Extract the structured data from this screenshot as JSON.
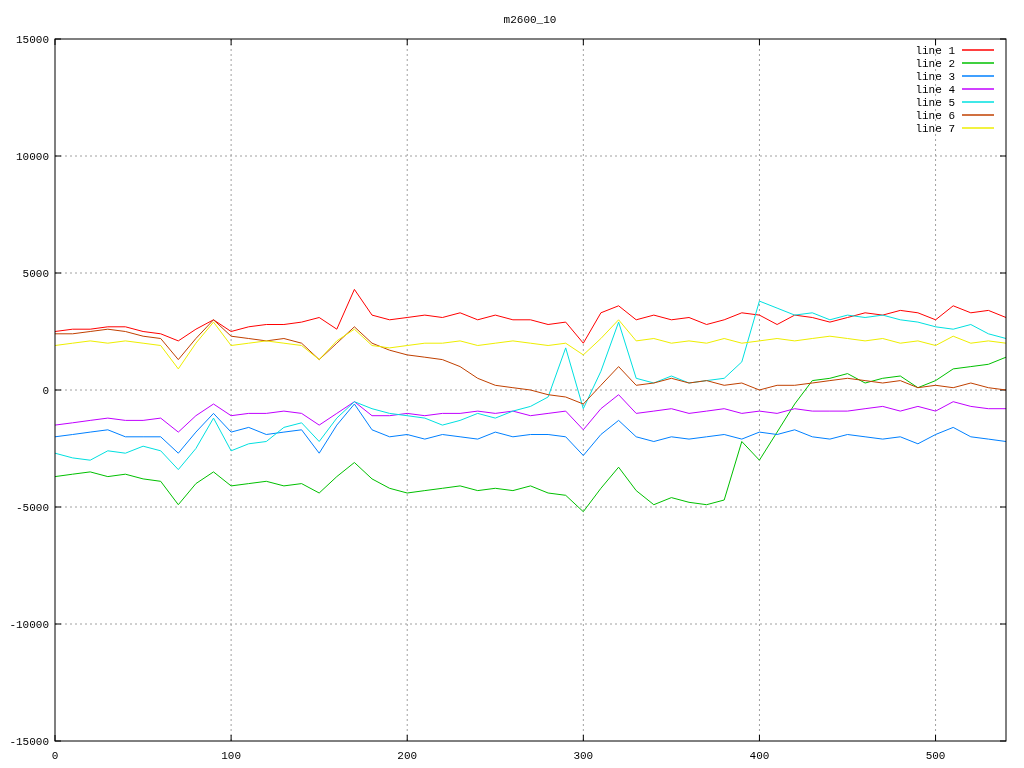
{
  "chart_data": {
    "type": "line",
    "title": "m2600_10",
    "x": [
      0,
      10,
      20,
      30,
      40,
      50,
      60,
      70,
      80,
      90,
      100,
      110,
      120,
      130,
      140,
      150,
      160,
      170,
      180,
      190,
      200,
      210,
      220,
      230,
      240,
      250,
      260,
      270,
      280,
      290,
      300,
      310,
      320,
      330,
      340,
      350,
      360,
      370,
      380,
      390,
      400,
      410,
      420,
      430,
      440,
      450,
      460,
      470,
      480,
      490,
      500,
      510,
      520,
      530,
      540
    ],
    "series": [
      {
        "name": "line 1",
        "color": "#ff0000",
        "values": [
          2500,
          2600,
          2600,
          2700,
          2700,
          2500,
          2400,
          2100,
          2600,
          3000,
          2500,
          2700,
          2800,
          2800,
          2900,
          3100,
          2600,
          4300,
          3200,
          3000,
          3100,
          3200,
          3100,
          3300,
          3000,
          3200,
          3000,
          3000,
          2800,
          2900,
          2000,
          3300,
          3600,
          3000,
          3200,
          3000,
          3100,
          2800,
          3000,
          3300,
          3200,
          2800,
          3200,
          3100,
          2900,
          3100,
          3300,
          3200,
          3400,
          3300,
          3000,
          3600,
          3300,
          3400,
          3100
        ]
      },
      {
        "name": "line 2",
        "color": "#00c000",
        "values": [
          -3700,
          -3600,
          -3500,
          -3700,
          -3600,
          -3800,
          -3900,
          -4900,
          -4000,
          -3500,
          -4100,
          -4000,
          -3900,
          -4100,
          -4000,
          -4400,
          -3700,
          -3100,
          -3800,
          -4200,
          -4400,
          -4300,
          -4200,
          -4100,
          -4300,
          -4200,
          -4300,
          -4100,
          -4400,
          -4500,
          -5200,
          -4200,
          -3300,
          -4300,
          -4900,
          -4600,
          -4800,
          -4900,
          -4700,
          -2200,
          -3000,
          -1800,
          -600,
          400,
          500,
          700,
          300,
          500,
          600,
          100,
          400,
          900,
          1000,
          1100,
          1400
        ]
      },
      {
        "name": "line 3",
        "color": "#0080ff",
        "values": [
          -2000,
          -1900,
          -1800,
          -1700,
          -2000,
          -2000,
          -2000,
          -2700,
          -1800,
          -1000,
          -1800,
          -1600,
          -1900,
          -1800,
          -1700,
          -2700,
          -1500,
          -600,
          -1700,
          -2000,
          -1900,
          -2100,
          -1900,
          -2000,
          -2100,
          -1800,
          -2000,
          -1900,
          -1900,
          -2000,
          -2800,
          -1900,
          -1300,
          -2000,
          -2200,
          -2000,
          -2100,
          -2000,
          -1900,
          -2100,
          -1800,
          -1900,
          -1700,
          -2000,
          -2100,
          -1900,
          -2000,
          -2100,
          -2000,
          -2300,
          -1900,
          -1600,
          -2000,
          -2100,
          -2200
        ]
      },
      {
        "name": "line 4",
        "color": "#c000ff",
        "values": [
          -1500,
          -1400,
          -1300,
          -1200,
          -1300,
          -1300,
          -1200,
          -1800,
          -1100,
          -600,
          -1100,
          -1000,
          -1000,
          -900,
          -1000,
          -1500,
          -1000,
          -500,
          -1100,
          -1100,
          -1000,
          -1100,
          -1000,
          -1000,
          -900,
          -1000,
          -900,
          -1100,
          -1000,
          -900,
          -1700,
          -800,
          -200,
          -1000,
          -900,
          -800,
          -1000,
          -900,
          -800,
          -1000,
          -900,
          -1000,
          -800,
          -900,
          -900,
          -900,
          -800,
          -700,
          -900,
          -700,
          -900,
          -500,
          -700,
          -800,
          -800
        ]
      },
      {
        "name": "line 5",
        "color": "#00e0e0",
        "values": [
          -2700,
          -2900,
          -3000,
          -2600,
          -2700,
          -2400,
          -2600,
          -3400,
          -2500,
          -1200,
          -2600,
          -2300,
          -2200,
          -1600,
          -1400,
          -2200,
          -1200,
          -500,
          -800,
          -1000,
          -1100,
          -1200,
          -1500,
          -1300,
          -1000,
          -1200,
          -900,
          -700,
          -300,
          1800,
          -800,
          800,
          2900,
          500,
          300,
          600,
          300,
          400,
          500,
          1200,
          3800,
          3500,
          3200,
          3300,
          3000,
          3200,
          3100,
          3200,
          3000,
          2900,
          2700,
          2600,
          2800,
          2400,
          2200
        ]
      },
      {
        "name": "line 6",
        "color": "#c04000",
        "values": [
          2400,
          2400,
          2500,
          2600,
          2500,
          2300,
          2200,
          1300,
          2200,
          3000,
          2300,
          2200,
          2100,
          2200,
          2000,
          1300,
          2000,
          2700,
          2000,
          1700,
          1500,
          1400,
          1300,
          1000,
          500,
          200,
          100,
          0,
          -200,
          -300,
          -600,
          200,
          1000,
          200,
          300,
          500,
          300,
          400,
          200,
          300,
          0,
          200,
          200,
          300,
          400,
          500,
          400,
          300,
          400,
          100,
          200,
          100,
          300,
          100,
          0
        ]
      },
      {
        "name": "line 7",
        "color": "#eeee00",
        "values": [
          1900,
          2000,
          2100,
          2000,
          2100,
          2000,
          1900,
          900,
          2000,
          2900,
          1900,
          2000,
          2100,
          2000,
          1900,
          1300,
          2100,
          2600,
          1900,
          1800,
          1900,
          2000,
          2000,
          2100,
          1900,
          2000,
          2100,
          2000,
          1900,
          2000,
          1500,
          2200,
          3000,
          2100,
          2200,
          2000,
          2100,
          2000,
          2200,
          2000,
          2100,
          2200,
          2100,
          2200,
          2300,
          2200,
          2100,
          2200,
          2000,
          2100,
          1900,
          2300,
          2000,
          2100,
          2000
        ]
      }
    ],
    "grid": true,
    "legend": true,
    "xlim": [
      0,
      540
    ],
    "ylim": [
      -15000,
      15000
    ],
    "xticks": [
      0,
      100,
      200,
      300,
      400,
      500
    ],
    "yticks": [
      -15000,
      -10000,
      -5000,
      0,
      5000,
      10000,
      15000
    ]
  }
}
